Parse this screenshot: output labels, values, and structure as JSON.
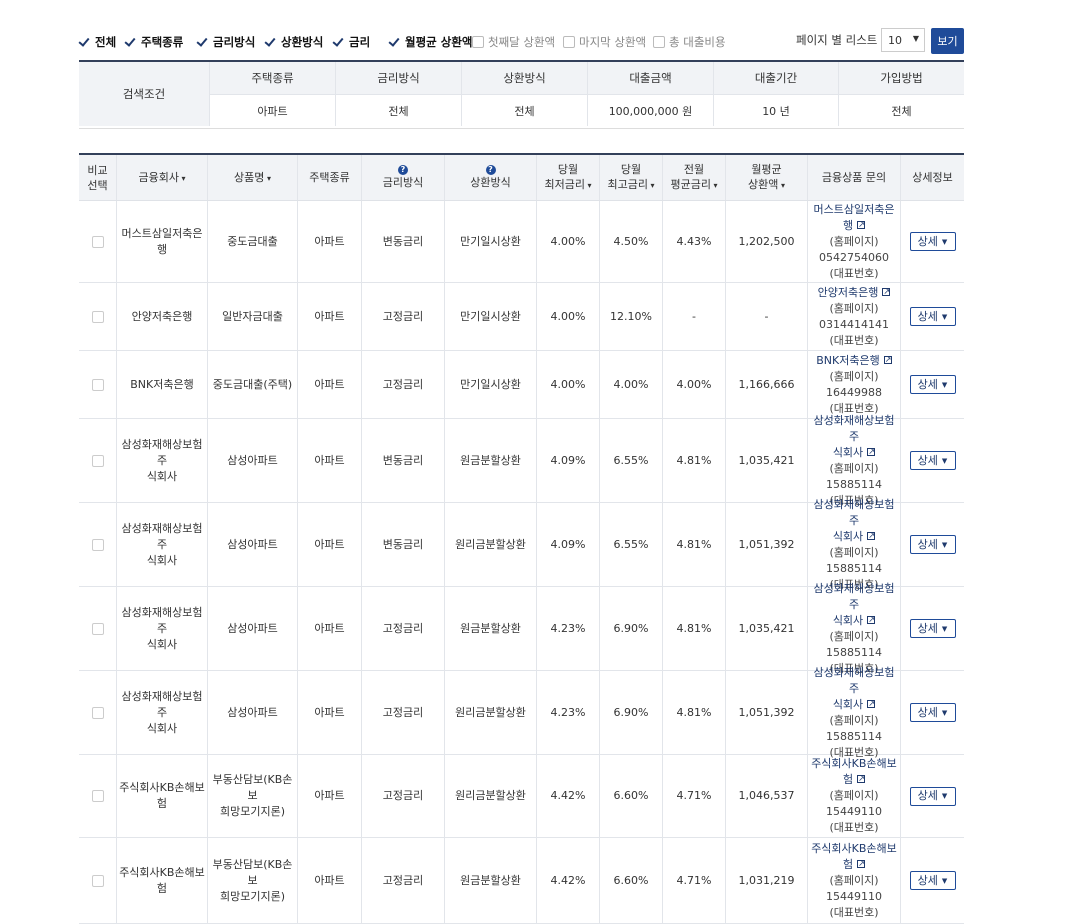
{
  "filters": [
    {
      "label": "전체",
      "checked": true
    },
    {
      "label": "주택종류",
      "checked": true
    },
    {
      "label": "금리방식",
      "checked": true
    },
    {
      "label": "상환방식",
      "checked": true
    },
    {
      "label": "금리",
      "checked": true
    },
    {
      "label": "월평균 상환액",
      "checked": true
    },
    {
      "label": "첫째달 상환액",
      "checked": false
    },
    {
      "label": "마지막 상환액",
      "checked": false
    },
    {
      "label": "총 대출비용",
      "checked": false
    }
  ],
  "per_page": {
    "label": "페이지 별 리스트 :",
    "value": "10",
    "button": "보기"
  },
  "search_conditions": {
    "label": "검색조건",
    "headers": [
      "주택종류",
      "금리방식",
      "상환방식",
      "대출금액",
      "대출기간",
      "가입방법"
    ],
    "values": [
      "아파트",
      "전체",
      "전체",
      "100,000,000 원",
      "10 년",
      "전체"
    ]
  },
  "table": {
    "headers": [
      {
        "lines": [
          "비교",
          "선택"
        ],
        "sort": false,
        "help": false
      },
      {
        "lines": [
          "금융회사"
        ],
        "sort": true,
        "help": false
      },
      {
        "lines": [
          "상품명"
        ],
        "sort": true,
        "help": false
      },
      {
        "lines": [
          "주택종류"
        ],
        "sort": false,
        "help": false
      },
      {
        "lines": [
          "금리방식"
        ],
        "sort": false,
        "help": true
      },
      {
        "lines": [
          "상환방식"
        ],
        "sort": false,
        "help": true
      },
      {
        "lines": [
          "당월",
          "최저금리"
        ],
        "sort": true,
        "help": false
      },
      {
        "lines": [
          "당월",
          "최고금리"
        ],
        "sort": true,
        "help": false
      },
      {
        "lines": [
          "전월",
          "평균금리"
        ],
        "sort": true,
        "help": false
      },
      {
        "lines": [
          "월평균",
          "상환액"
        ],
        "sort": true,
        "help": false
      },
      {
        "lines": [
          "금융상품 문의"
        ],
        "sort": false,
        "help": false
      },
      {
        "lines": [
          "상세정보"
        ],
        "sort": false,
        "help": false
      }
    ],
    "help_glyph": "?",
    "detail_label": "상세",
    "homepage_label": "(홈페이지)",
    "rep_label": "(대표번호)",
    "rows": [
      {
        "company": [
          "머스트삼일저축은행"
        ],
        "product": [
          "중도금대출"
        ],
        "house": "아파트",
        "rate_type": "변동금리",
        "repay": "만기일시상환",
        "min": "4.00%",
        "max": "4.50%",
        "avg": "4.43%",
        "monthly": "1,202,500",
        "inq_company": [
          "머스트삼일저축은행"
        ],
        "phone": "0542754060"
      },
      {
        "company": [
          "안양저축은행"
        ],
        "product": [
          "일반자금대출"
        ],
        "house": "아파트",
        "rate_type": "고정금리",
        "repay": "만기일시상환",
        "min": "4.00%",
        "max": "12.10%",
        "avg": "-",
        "monthly": "-",
        "inq_company": [
          "안양저축은행"
        ],
        "phone": "0314414141"
      },
      {
        "company": [
          "BNK저축은행"
        ],
        "product": [
          "중도금대출(주택)"
        ],
        "house": "아파트",
        "rate_type": "고정금리",
        "repay": "만기일시상환",
        "min": "4.00%",
        "max": "4.00%",
        "avg": "4.00%",
        "monthly": "1,166,666",
        "inq_company": [
          "BNK저축은행"
        ],
        "phone": "16449988"
      },
      {
        "company": [
          "삼성화재해상보험주",
          "식회사"
        ],
        "product": [
          "삼성아파트"
        ],
        "house": "아파트",
        "rate_type": "변동금리",
        "repay": "원금분할상환",
        "min": "4.09%",
        "max": "6.55%",
        "avg": "4.81%",
        "monthly": "1,035,421",
        "inq_company": [
          "삼성화재해상보험주",
          "식회사"
        ],
        "phone": "15885114"
      },
      {
        "company": [
          "삼성화재해상보험주",
          "식회사"
        ],
        "product": [
          "삼성아파트"
        ],
        "house": "아파트",
        "rate_type": "변동금리",
        "repay": "원리금분할상환",
        "min": "4.09%",
        "max": "6.55%",
        "avg": "4.81%",
        "monthly": "1,051,392",
        "inq_company": [
          "삼성화재해상보험주",
          "식회사"
        ],
        "phone": "15885114"
      },
      {
        "company": [
          "삼성화재해상보험주",
          "식회사"
        ],
        "product": [
          "삼성아파트"
        ],
        "house": "아파트",
        "rate_type": "고정금리",
        "repay": "원금분할상환",
        "min": "4.23%",
        "max": "6.90%",
        "avg": "4.81%",
        "monthly": "1,035,421",
        "inq_company": [
          "삼성화재해상보험주",
          "식회사"
        ],
        "phone": "15885114"
      },
      {
        "company": [
          "삼성화재해상보험주",
          "식회사"
        ],
        "product": [
          "삼성아파트"
        ],
        "house": "아파트",
        "rate_type": "고정금리",
        "repay": "원리금분할상환",
        "min": "4.23%",
        "max": "6.90%",
        "avg": "4.81%",
        "monthly": "1,051,392",
        "inq_company": [
          "삼성화재해상보험주",
          "식회사"
        ],
        "phone": "15885114"
      },
      {
        "company": [
          "주식회사KB손해보",
          "험"
        ],
        "product": [
          "부동산담보(KB손보",
          "희망모기지론)"
        ],
        "house": "아파트",
        "rate_type": "고정금리",
        "repay": "원리금분할상환",
        "min": "4.42%",
        "max": "6.60%",
        "avg": "4.71%",
        "monthly": "1,046,537",
        "inq_company": [
          "주식회사KB손해보",
          "험"
        ],
        "phone": "15449110"
      },
      {
        "company": [
          "주식회사KB손해보",
          "험"
        ],
        "product": [
          "부동산담보(KB손보",
          "희망모기지론)"
        ],
        "house": "아파트",
        "rate_type": "고정금리",
        "repay": "원금분할상환",
        "min": "4.42%",
        "max": "6.60%",
        "avg": "4.71%",
        "monthly": "1,031,219",
        "inq_company": [
          "주식회사KB손해보",
          "험"
        ],
        "phone": "15449110"
      }
    ]
  },
  "colors": {
    "primary": "#1f4b99",
    "header_bg": "#f1f3f6",
    "border_dark": "#33405a"
  },
  "icons": [
    "check-icon",
    "help-icon",
    "external-link-icon",
    "caret-down-icon"
  ]
}
